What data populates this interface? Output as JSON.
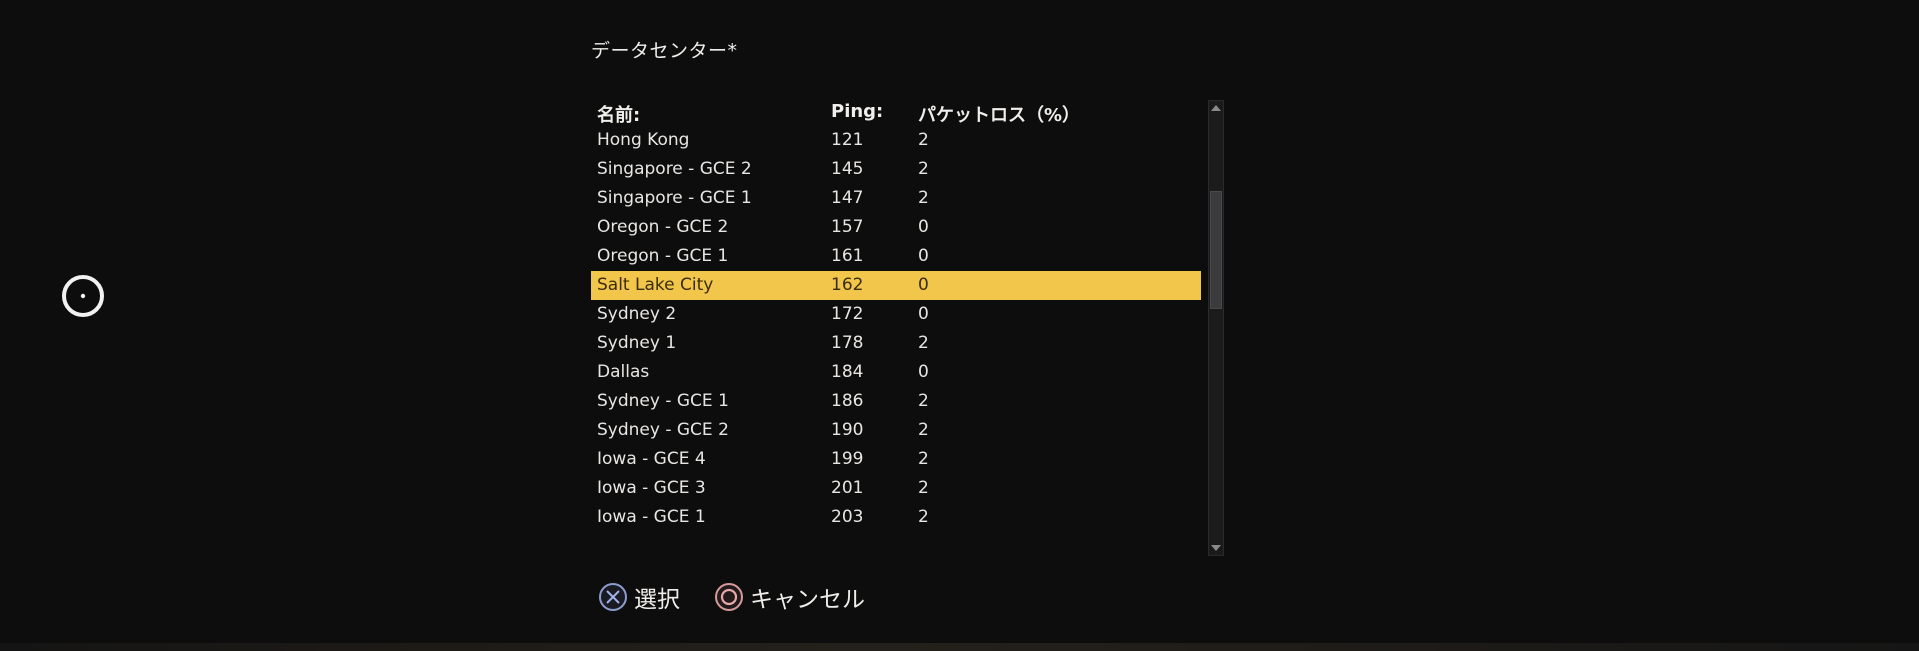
{
  "dialog": {
    "title": "データセンター*"
  },
  "table": {
    "headers": {
      "name": "名前:",
      "ping": "Ping:",
      "loss": "パケットロス（%）"
    },
    "rows": [
      {
        "name": "Hong Kong",
        "ping": "121",
        "loss": "2"
      },
      {
        "name": "Singapore - GCE 2",
        "ping": "145",
        "loss": "2"
      },
      {
        "name": "Singapore - GCE 1",
        "ping": "147",
        "loss": "2"
      },
      {
        "name": "Oregon - GCE 2",
        "ping": "157",
        "loss": "0"
      },
      {
        "name": "Oregon - GCE 1",
        "ping": "161",
        "loss": "0"
      },
      {
        "name": "Salt Lake City",
        "ping": "162",
        "loss": "0",
        "selected": true
      },
      {
        "name": "Sydney 2",
        "ping": "172",
        "loss": "0"
      },
      {
        "name": "Sydney 1",
        "ping": "178",
        "loss": "2"
      },
      {
        "name": "Dallas",
        "ping": "184",
        "loss": "0"
      },
      {
        "name": "Sydney - GCE 1",
        "ping": "186",
        "loss": "2"
      },
      {
        "name": "Sydney - GCE 2",
        "ping": "190",
        "loss": "2"
      },
      {
        "name": "Iowa - GCE 4",
        "ping": "199",
        "loss": "2"
      },
      {
        "name": "Iowa - GCE 3",
        "ping": "201",
        "loss": "2"
      },
      {
        "name": "Iowa - GCE 1",
        "ping": "203",
        "loss": "2"
      }
    ]
  },
  "footer": {
    "select_label": "選択",
    "select_icon": "cross-button-icon",
    "cancel_label": "キャンセル",
    "cancel_icon": "circle-button-icon"
  },
  "colors": {
    "background": "#0e0d0e",
    "selected_row": "#f2c64a",
    "cross_icon": "#8d9ccf",
    "circle_icon": "#d79a9a"
  }
}
